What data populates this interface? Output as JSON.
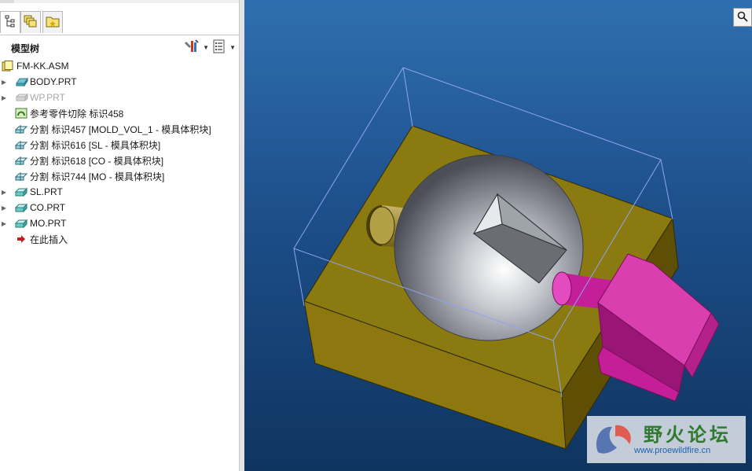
{
  "tabs": [
    {
      "icon": "model-tree-icon"
    },
    {
      "icon": "layers-icon"
    },
    {
      "icon": "favorites-folder-icon"
    }
  ],
  "tree_header": {
    "title": "模型树",
    "tools": [
      "settings-icon",
      "show-options-icon"
    ]
  },
  "tree": {
    "root": "FM-KK.ASM",
    "items": [
      {
        "label": "BODY.PRT",
        "icon": "part-icon",
        "expandable": true,
        "dimmed": false
      },
      {
        "label": "WP.PRT",
        "icon": "workpiece-icon",
        "expandable": true,
        "dimmed": true
      },
      {
        "label": "参考零件切除 标识458",
        "icon": "ref-cut-icon",
        "expandable": false,
        "dimmed": false
      },
      {
        "label": "分割 标识457 [MOLD_VOL_1 - 模具体积块]",
        "icon": "split-icon",
        "expandable": false,
        "dimmed": false
      },
      {
        "label": "分割 标识616 [SL - 模具体积块]",
        "icon": "split-icon",
        "expandable": false,
        "dimmed": false
      },
      {
        "label": "分割 标识618 [CO - 模具体积块]",
        "icon": "split-icon",
        "expandable": false,
        "dimmed": false
      },
      {
        "label": "分割 标识744 [MO - 模具体积块]",
        "icon": "split-icon",
        "expandable": false,
        "dimmed": false
      },
      {
        "label": "SL.PRT",
        "icon": "mold-part-icon",
        "expandable": true,
        "dimmed": false
      },
      {
        "label": "CO.PRT",
        "icon": "mold-part-icon",
        "expandable": true,
        "dimmed": false
      },
      {
        "label": "MO.PRT",
        "icon": "mold-part-icon",
        "expandable": true,
        "dimmed": false
      },
      {
        "label": "在此插入",
        "icon": "insert-here-arrow-icon",
        "expandable": false,
        "dimmed": false
      }
    ]
  },
  "viewport": {
    "background_top": "#2f6fb0",
    "background_bottom": "#0f3460",
    "mold_color": "#8a7a10",
    "sphere_color": "#b9bcc3",
    "slider_color": "#d93fae",
    "watermark": {
      "title": "野火论坛",
      "url": "www.proewildfire.cn"
    }
  }
}
